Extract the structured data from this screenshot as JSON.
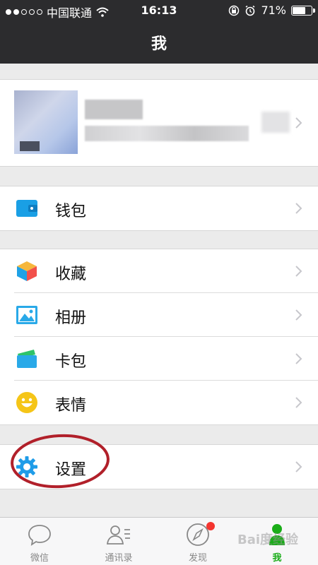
{
  "status_bar": {
    "carrier": "中国联通",
    "time": "16:13",
    "battery": "71%",
    "battery_level": 0.71
  },
  "nav": {
    "title": "我"
  },
  "menu": {
    "wallet": "钱包",
    "favorites": "收藏",
    "album": "相册",
    "cards": "卡包",
    "stickers": "表情",
    "settings": "设置"
  },
  "tabs": [
    {
      "label": "微信",
      "active": false
    },
    {
      "label": "通讯录",
      "active": false
    },
    {
      "label": "发现",
      "active": false,
      "badge": true
    },
    {
      "label": "我",
      "active": true
    }
  ],
  "watermark": "Bai度经验",
  "colors": {
    "accent_green": "#1aad19",
    "header_bg": "#2c2c2e",
    "annotation_red": "#b1202a"
  }
}
